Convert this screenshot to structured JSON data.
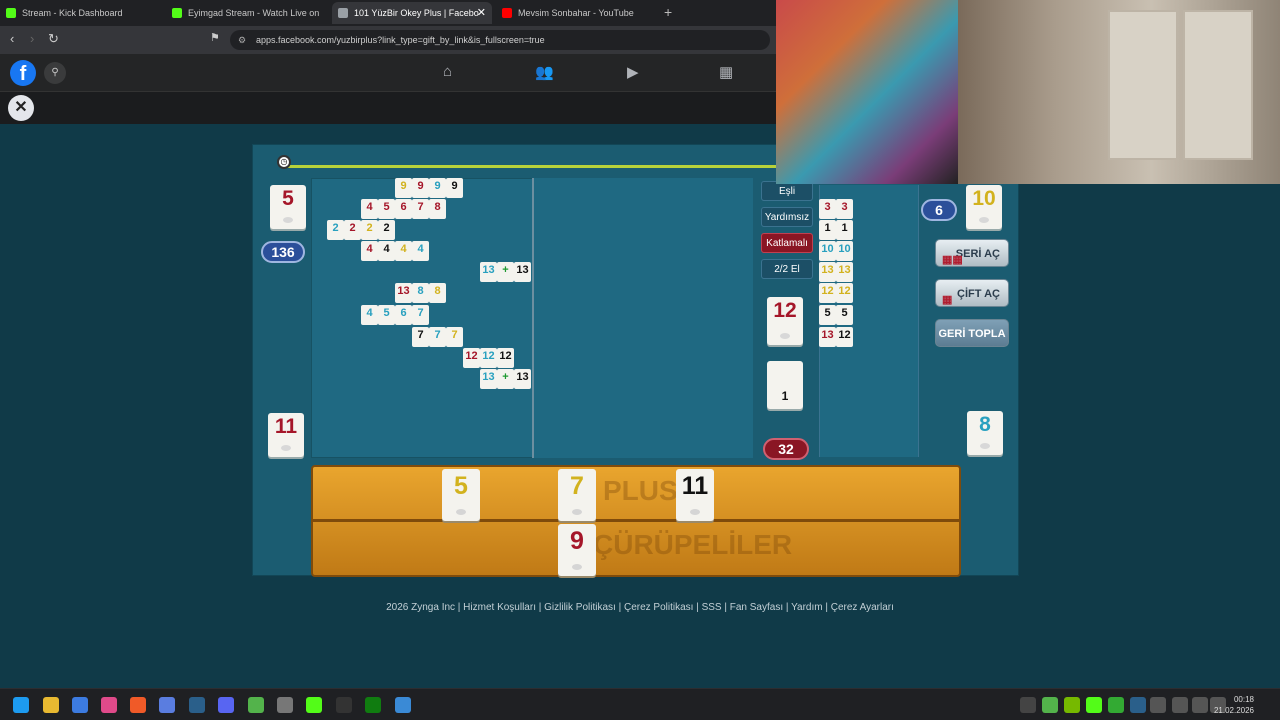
{
  "browser": {
    "tabs": [
      {
        "label": "Stream - Kick Dashboard",
        "active": false,
        "favicon_color": "#53fc18"
      },
      {
        "label": "Eyimgad Stream - Watch Live on",
        "active": false,
        "favicon_color": "#53fc18"
      },
      {
        "label": "101 YüzBir Okey Plus | Facebo",
        "active": true,
        "favicon_color": "#9aa0a6"
      },
      {
        "label": "Mevsim Sonbahar - YouTube",
        "active": false,
        "favicon_color": "#ff0000"
      }
    ],
    "url": "apps.facebook.com/yuzbirplus?link_type=gift_by_link&is_fullscreen=true"
  },
  "game": {
    "top_left_tile": "5",
    "score_left": "136",
    "bottom_left_tile": "11",
    "top_right_tile": "10",
    "score_right": "6",
    "bottom_right_tile": "8",
    "indicator_tile": "12",
    "blank_tile_number": "1",
    "remaining_count": "32",
    "labels": {
      "esli": "Eşli",
      "yardimsiz": "Yardımsız",
      "katlamali": "Katlamalı",
      "round": "2/2 El"
    },
    "buttons": {
      "seri_ac": "SERİ AÇ",
      "cift_ac": "ÇİFT AÇ",
      "geri_topla": "GERİ TOPLA"
    },
    "rack_top": [
      {
        "value": "5",
        "color": "yellow"
      },
      {
        "value": "7",
        "color": "yellow"
      },
      {
        "value": "11",
        "color": "black"
      }
    ],
    "rack_bottom": [
      {
        "value": "9",
        "color": "red"
      }
    ],
    "board_rows": [
      [
        "9",
        "9",
        "9",
        "9"
      ],
      [
        "4",
        "5",
        "6",
        "7",
        "8"
      ],
      [
        "2",
        "2",
        "2",
        "2"
      ],
      [
        "4",
        "4",
        "4",
        "4"
      ],
      [
        "13",
        "+",
        "13"
      ],
      [
        "13",
        "8",
        "8"
      ],
      [
        "4",
        "5",
        "6",
        "7"
      ],
      [
        "7",
        "7",
        "7"
      ],
      [
        "12",
        "12",
        "12"
      ],
      [
        "13",
        "+",
        "13"
      ]
    ],
    "right_pairs": [
      [
        "3",
        "3"
      ],
      [
        "1",
        "1"
      ],
      [
        "10",
        "10"
      ],
      [
        "13",
        "13"
      ],
      [
        "12",
        "12"
      ],
      [
        "5",
        "5"
      ],
      [
        "13",
        "12"
      ]
    ],
    "rack_watermarks": [
      "PLUS",
      "ÇÜRÜPELİLER"
    ]
  },
  "footer": "2026 Zynga Inc | Hizmet Koşulları | Gizlilik Politikası | Çerez Politikası | SSS | Fan Sayfası | Yardım | Çerez Ayarları",
  "taskbar": {
    "time": "00:18",
    "date": "21.02.2026"
  }
}
